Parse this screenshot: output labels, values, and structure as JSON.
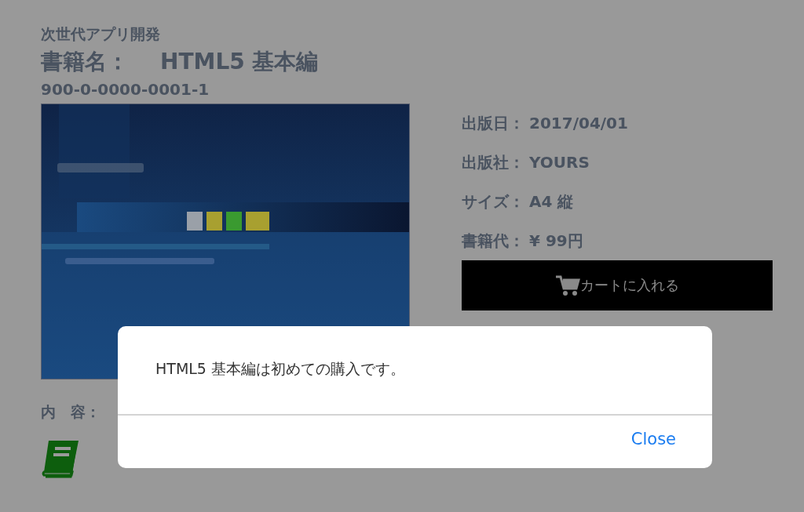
{
  "series_title": "次世代アプリ開発",
  "book_title": {
    "label": "書籍名：",
    "value": "HTML5 基本編"
  },
  "isbn": "900-0-0000-0001-1",
  "details": [
    {
      "label": "出版日：",
      "value": "2017/04/01"
    },
    {
      "label": "出版社：",
      "value": "YOURS"
    },
    {
      "label": "サイズ：",
      "value": "A4 縦"
    },
    {
      "label": "書籍代：",
      "value": "¥ 99円"
    }
  ],
  "cart_button": "カートに入れる",
  "contents_label": "内　容：",
  "dialog": {
    "message": "HTML5 基本編は初めての購入です。",
    "button": "Close"
  }
}
